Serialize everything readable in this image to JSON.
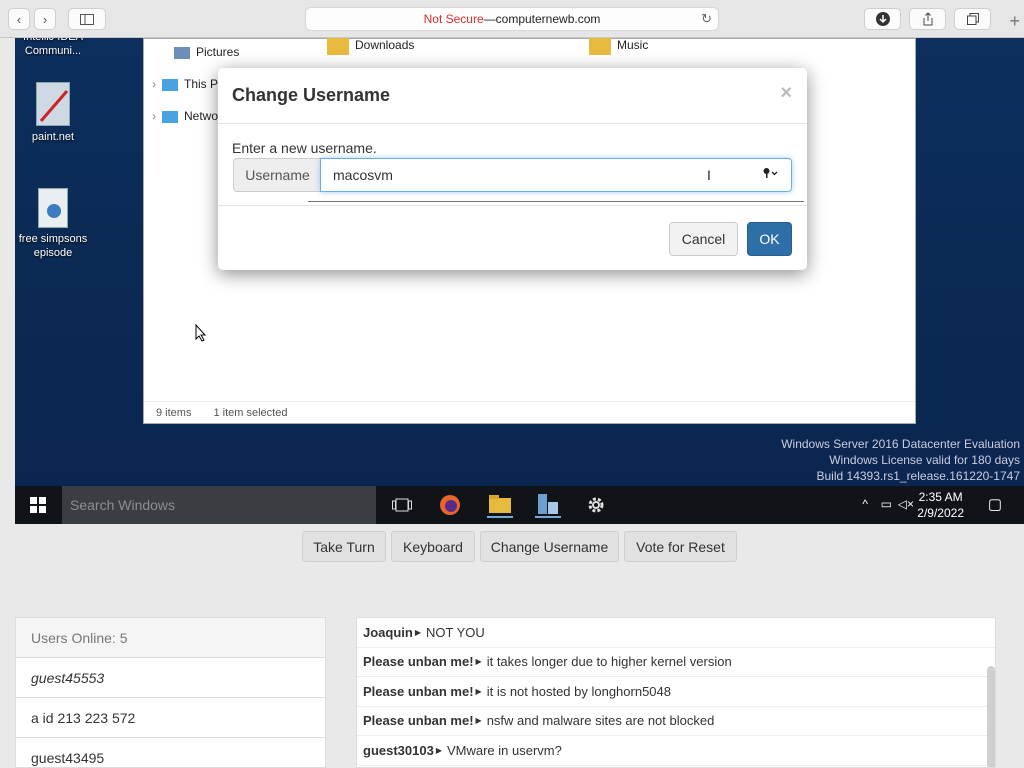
{
  "browser": {
    "not_secure": "Not Secure",
    "separator": " — ",
    "domain": "computernewb.com",
    "icons": [
      "back-icon",
      "forward-icon",
      "sidebar-icon",
      "reload-icon",
      "download-icon",
      "share-icon",
      "tabs-icon",
      "new-tab-icon"
    ]
  },
  "desktop": {
    "icons": [
      {
        "label": "IntelliJ IDEA Communi...",
        "icon": "intellij-icon"
      },
      {
        "label": "paint.net",
        "icon": "paintnet-icon"
      },
      {
        "label": "free simpsons episode",
        "icon": "media-file-icon"
      }
    ],
    "explorer": {
      "sidebar": [
        "Pictures",
        "This PC",
        "Network"
      ],
      "folders": [
        "Downloads",
        "Music"
      ],
      "status_count": "9 items",
      "status_selected": "1 item selected"
    },
    "watermark": [
      "Windows Server 2016 Datacenter Evaluation",
      "Windows License valid for 180 days",
      "Build 14393.rs1_release.161220-1747"
    ],
    "taskbar": {
      "search_placeholder": "Search Windows",
      "time": "2:35 AM",
      "date": "2/9/2022"
    }
  },
  "modal": {
    "title": "Change Username",
    "close": "×",
    "prompt": "Enter a new username.",
    "addon_label": "Username",
    "input_value": "macosvm",
    "cancel_label": "Cancel",
    "ok_label": "OK"
  },
  "actions": {
    "take_turn": "Take Turn",
    "keyboard": "Keyboard",
    "change_username": "Change Username",
    "vote_reset": "Vote for Reset"
  },
  "users": {
    "header": "Users Online: 5",
    "list": [
      "guest45553",
      "a id 213 223 572",
      "guest43495"
    ]
  },
  "chat": [
    {
      "user": "Joaquin",
      "msg": "NOT YOU"
    },
    {
      "user": "Please unban me!",
      "msg": "it takes longer due to higher kernel version"
    },
    {
      "user": "Please unban me!",
      "msg": "it is not hosted by longhorn5048"
    },
    {
      "user": "Please unban me!",
      "msg": "nsfw and malware sites are not blocked"
    },
    {
      "user": "guest30103",
      "msg": "VMware in uservm?"
    }
  ],
  "colors": {
    "primary": "#2f6fa8",
    "not_secure": "#d0312d",
    "desktop": "#0d2f5e"
  }
}
